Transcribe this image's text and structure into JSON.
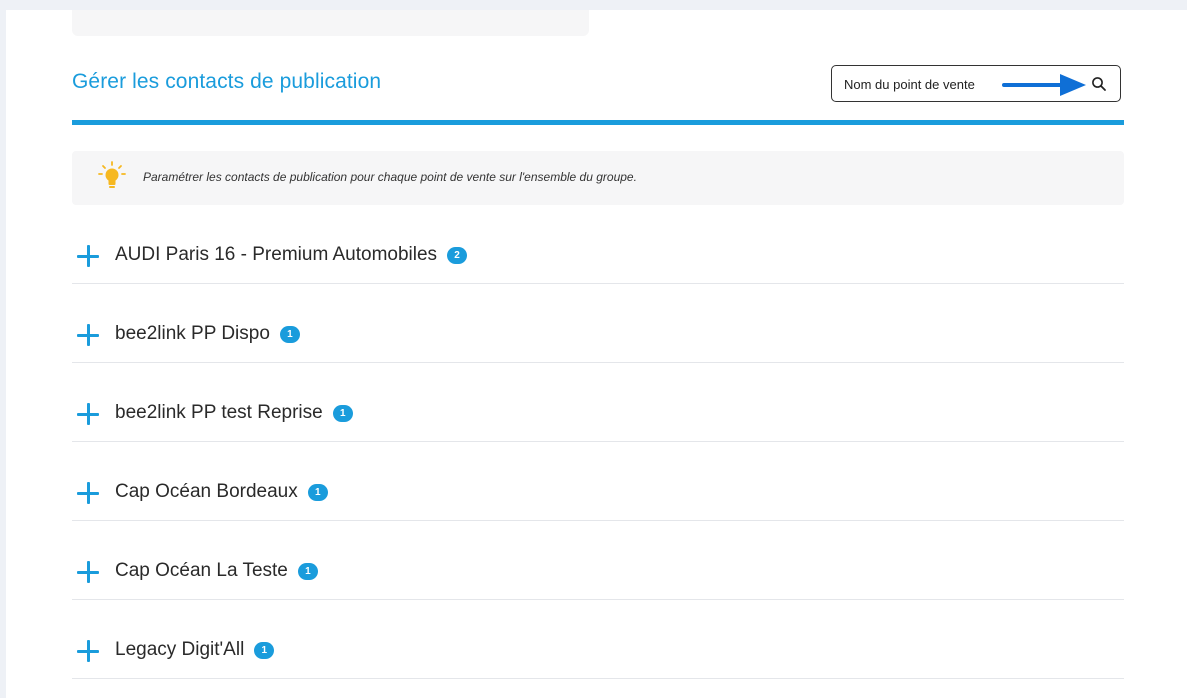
{
  "header": {
    "title": "Gérer les contacts de publication"
  },
  "search": {
    "placeholder": "Nom du point de vente"
  },
  "info": {
    "text": "Paramétrer les contacts de publication pour chaque point de vente sur l'ensemble du groupe."
  },
  "points_de_vente": [
    {
      "label": "AUDI Paris 16 - Premium Automobiles",
      "count": "2"
    },
    {
      "label": "bee2link PP Dispo",
      "count": "1"
    },
    {
      "label": "bee2link PP test Reprise",
      "count": "1"
    },
    {
      "label": "Cap Océan Bordeaux",
      "count": "1"
    },
    {
      "label": "Cap Océan La Teste",
      "count": "1"
    },
    {
      "label": "Legacy Digit'All",
      "count": "1"
    }
  ],
  "colors": {
    "accent": "#1a9cdc",
    "annotation_arrow": "#0f6fd6",
    "bulb": "#f6b820"
  },
  "icons": {
    "search": "search-icon",
    "bulb": "lightbulb-icon",
    "expand": "plus-icon",
    "annotation": "arrow-annotation-icon"
  }
}
